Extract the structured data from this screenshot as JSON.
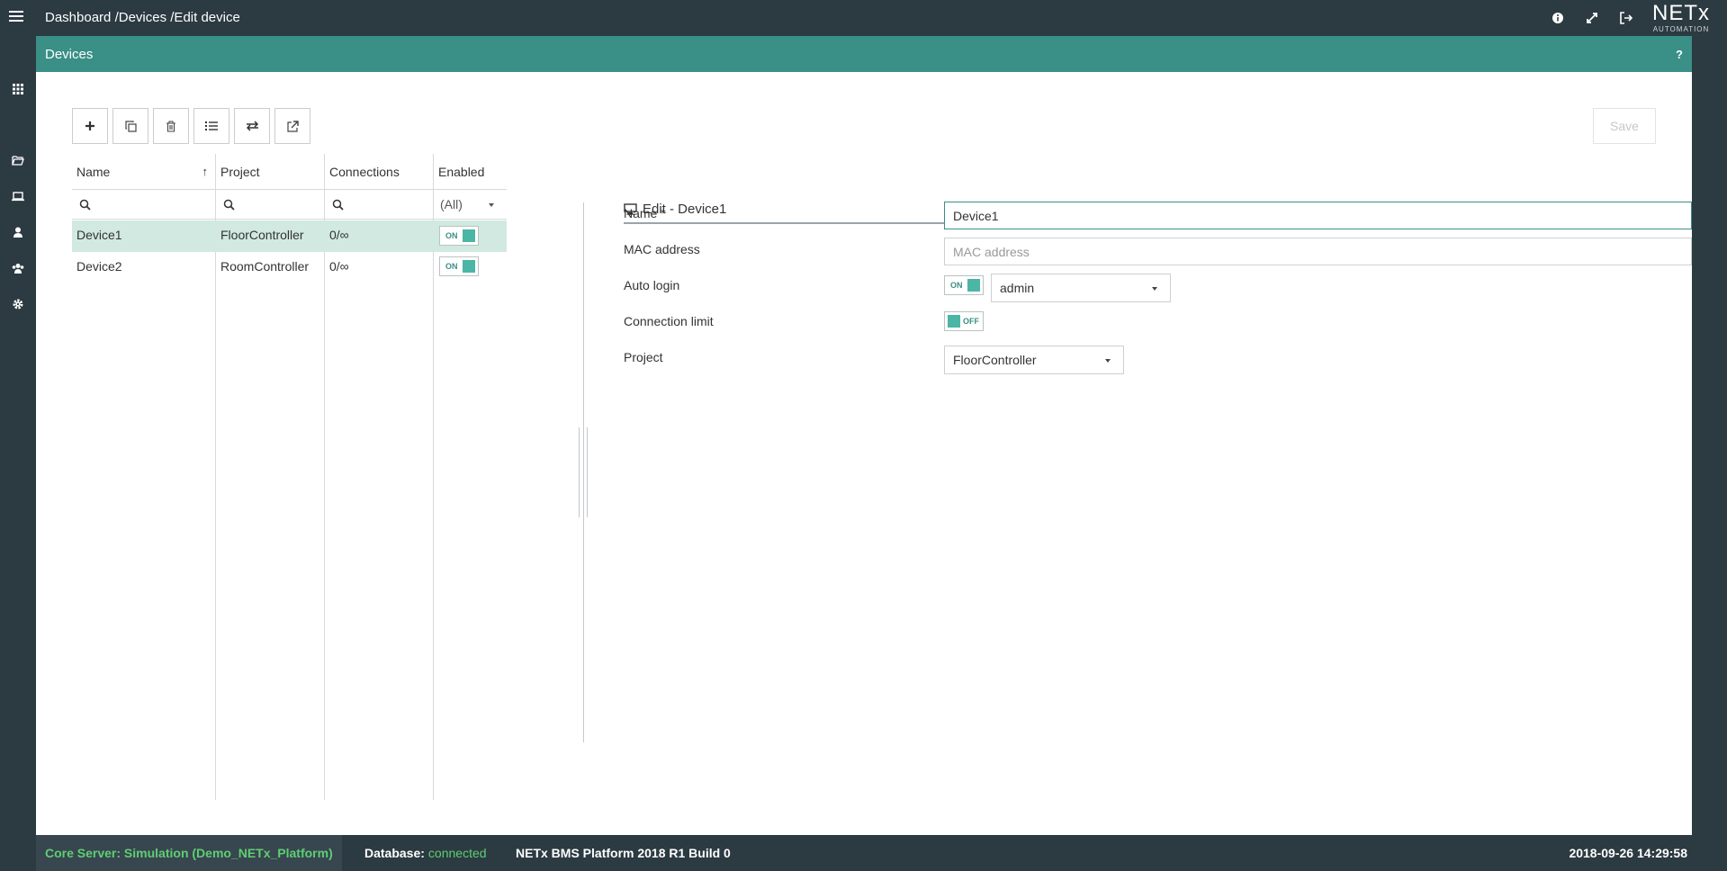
{
  "breadcrumb": {
    "items": [
      "Dashboard",
      "/Devices",
      "/Edit device"
    ]
  },
  "top_icons": [
    "info-icon",
    "fullscreen-icon",
    "logout-icon"
  ],
  "logo": {
    "brand": "NETx",
    "sub": "AUTOMATION"
  },
  "nav_items": [
    "dashboard-icon",
    "projects-icon",
    "devices-icon",
    "user-icon",
    "groups-icon",
    "settings-icon"
  ],
  "panel": {
    "title": "Devices",
    "help": "?"
  },
  "toolbar": {
    "buttons": [
      "add-icon",
      "copy-icon",
      "delete-icon",
      "list-icon",
      "swap-icon",
      "external-link-icon"
    ],
    "save_label": "Save"
  },
  "grid": {
    "columns": [
      "Name",
      "Project",
      "Connections",
      "Enabled"
    ],
    "sort_indicator": "↑",
    "enabled_filter": "(All)",
    "rows": [
      {
        "name": "Device1",
        "project": "FloorController",
        "connections": "0/∞",
        "enabled": "ON",
        "selected": true
      },
      {
        "name": "Device2",
        "project": "RoomController",
        "connections": "0/∞",
        "enabled": "ON",
        "selected": false
      }
    ]
  },
  "edit": {
    "title": "Edit - Device1",
    "labels": {
      "name": "Name *",
      "mac": "MAC address",
      "auto_login": "Auto login",
      "connection_limit": "Connection limit",
      "project": "Project"
    },
    "name_value": "Device1",
    "mac_placeholder": "MAC address",
    "auto_login_toggle": "ON",
    "auto_login_user": "admin",
    "connection_limit_toggle": "OFF",
    "project_value": "FloorController"
  },
  "statusbar": {
    "core": "Core Server: Simulation (Demo_NETx_Platform)",
    "db_label": "Database:",
    "db_value": "connected",
    "build": "NETx BMS Platform 2018 R1 Build 0",
    "datetime": "2018-09-26 14:29:58"
  },
  "colors": {
    "accent": "#3a8f86",
    "dark": "#2c3a42",
    "selected_row": "#d1e9e0",
    "status_green": "#5fce73"
  }
}
